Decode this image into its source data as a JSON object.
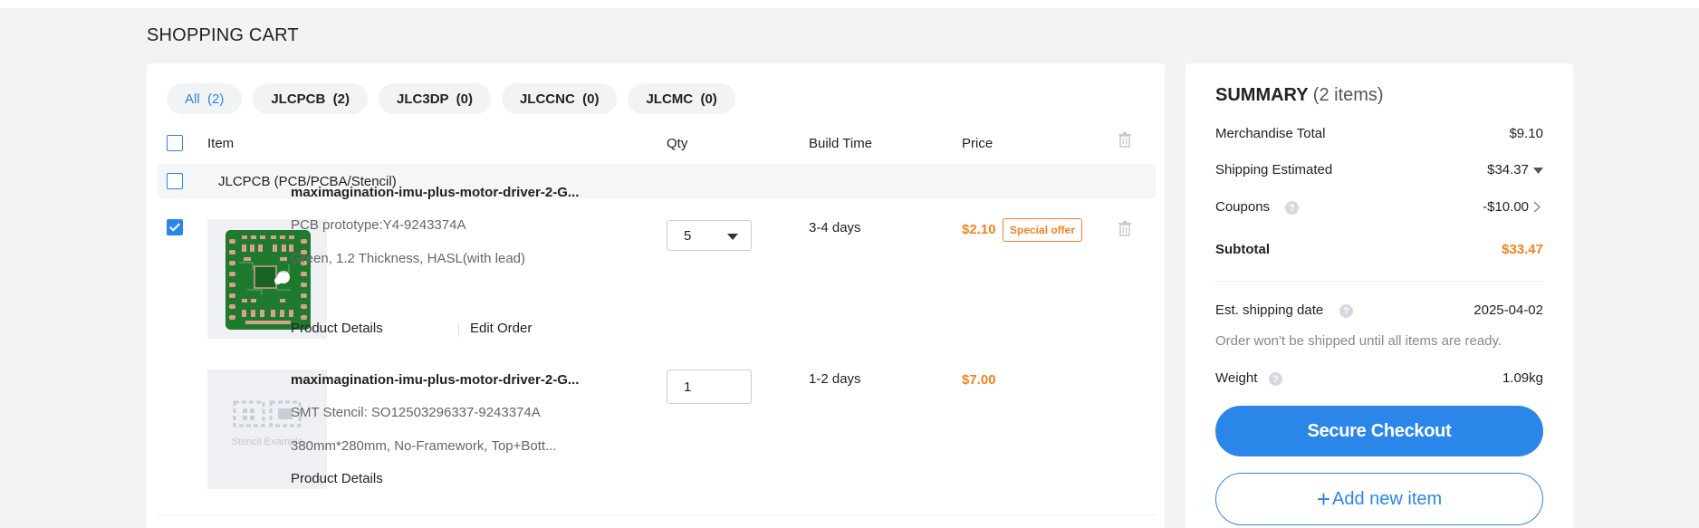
{
  "page": {
    "title": "SHOPPING CART"
  },
  "tabs": [
    {
      "label": "All  (2)"
    },
    {
      "label": "JLCPCB  (2)"
    },
    {
      "label": "JLC3DP  (0)"
    },
    {
      "label": "JLCCNC  (0)"
    },
    {
      "label": "JLCMC  (0)"
    }
  ],
  "columns": {
    "item": "Item",
    "qty": "Qty",
    "build_time": "Build Time",
    "price": "Price"
  },
  "group": {
    "label": "JLCPCB (PCB/PCBA/Stencil)"
  },
  "items": [
    {
      "name": "maximagination-imu-plus-motor-driver-2-G...",
      "line1": "PCB prototype:Y4-9243374A",
      "line2": "Green, 1.2 Thickness, HASL(with lead)",
      "product_details": "Product Details",
      "edit_order": "Edit Order",
      "qty": "5",
      "build_time": "3-4 days",
      "price": "$2.10",
      "badge": "Special offer",
      "checked": true
    },
    {
      "name": "maximagination-imu-plus-motor-driver-2-G...",
      "line1": "SMT Stencil: SO12503296337-9243374A",
      "line2": "380mm*280mm, No-Framework, Top+Bott...",
      "product_details": "Product Details",
      "qty": "1",
      "build_time": "1-2 days",
      "price": "$7.00",
      "thumb_label": "Stencil Example"
    }
  ],
  "summary": {
    "title": "SUMMARY",
    "count": "(2 items)",
    "merchandise_label": "Merchandise Total",
    "merchandise_value": "$9.10",
    "shipping_label": "Shipping Estimated",
    "shipping_value": "$34.37",
    "coupons_label": "Coupons",
    "coupons_value": "-$10.00",
    "subtotal_label": "Subtotal",
    "subtotal_value": "$33.47",
    "ship_date_label": "Est. shipping date",
    "ship_date_value": "2025-04-02",
    "ship_note": "Order won't be shipped until all items are ready.",
    "weight_label": "Weight",
    "weight_value": "1.09kg",
    "checkout_label": "Secure Checkout",
    "add_item_label": "Add new item"
  },
  "colors": {
    "accent": "#2b86ea",
    "price": "#f58220",
    "background": "#f2f3f5"
  },
  "icons": [
    "trash-icon",
    "help-icon",
    "chevron-right-icon",
    "caret-down-icon",
    "plus-icon",
    "checkbox"
  ]
}
